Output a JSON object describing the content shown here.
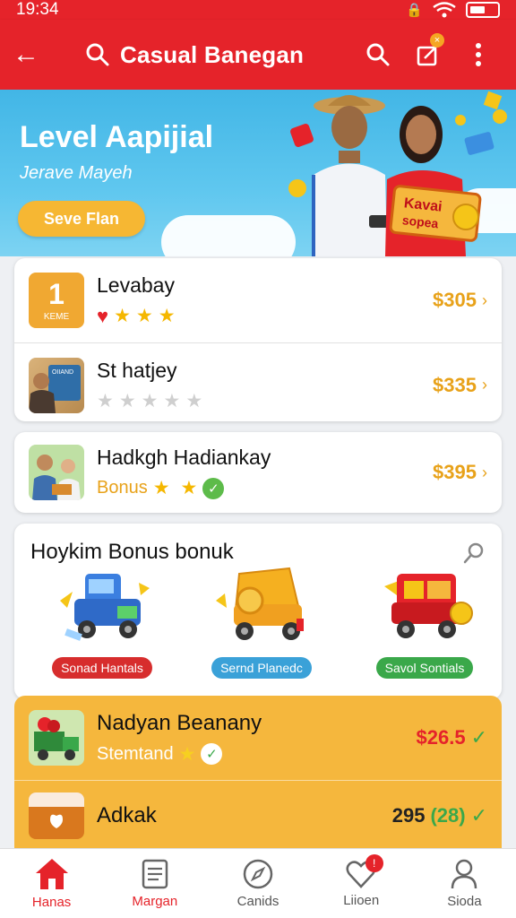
{
  "status": {
    "time": "19:34"
  },
  "appbar": {
    "title": "Casual Banegan"
  },
  "hero": {
    "title": "Level Aapijial",
    "subtitle": "Jerave Mayeh",
    "button": "Seve Flan",
    "sign_text_1": "Kavai",
    "sign_text_2": "sopea"
  },
  "list1": [
    {
      "badge_num": "1",
      "badge_text": "KEME",
      "name": "Levabay",
      "hearts": 1,
      "stars_filled": 3,
      "stars_total": 3,
      "price": "$305"
    },
    {
      "name": "St hatjey",
      "thumb_text": "OIIAND",
      "stars_filled": 0,
      "stars_total": 5,
      "price": "$335"
    }
  ],
  "list2": [
    {
      "name": "Hadkgh Hadiankay",
      "meta_label": "Bonus",
      "stars_filled": 2,
      "price": "$395"
    }
  ],
  "bonus": {
    "title": "Hoykim Bonus bonuk",
    "items": [
      {
        "label": "Sonad Hantals",
        "color": "#d72d2d"
      },
      {
        "label": "Sernd Planedc",
        "color": "#3aa1d8"
      },
      {
        "label": "Savol Sontials",
        "color": "#3aa84a"
      }
    ]
  },
  "orange_list": [
    {
      "name": "Nadyan Beanany",
      "sub": "Stemtand",
      "price": "$26.5"
    },
    {
      "name": "Adkak",
      "value": "295",
      "value_paren": "(28)"
    }
  ],
  "nav": [
    {
      "label": "Hanas",
      "icon": "home-icon",
      "active": true
    },
    {
      "label": "Margan",
      "icon": "document-icon",
      "active": false
    },
    {
      "label": "Canids",
      "icon": "compass-icon",
      "active": false
    },
    {
      "label": "Liioen",
      "icon": "heart-outline-icon",
      "active": false,
      "badge": "!"
    },
    {
      "label": "Sioda",
      "icon": "profile-icon",
      "active": false
    }
  ],
  "colors": {
    "primary": "#e5232a",
    "accent": "#f5b73d",
    "price": "#e8a21a"
  }
}
